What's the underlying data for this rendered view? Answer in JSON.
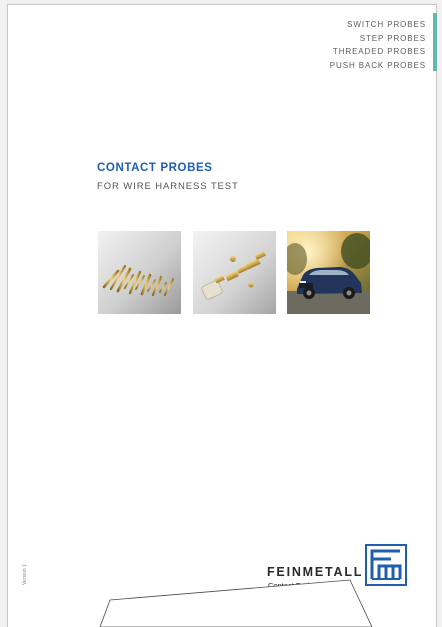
{
  "side_nav": {
    "items": [
      {
        "label": "SWITCH PROBES"
      },
      {
        "label": "STEP PROBES"
      },
      {
        "label": "THREADED PROBES"
      },
      {
        "label": "PUSH BACK PROBES"
      }
    ]
  },
  "cover": {
    "title": "CONTACT PROBES",
    "subtitle": "FOR WIRE HARNESS TEST"
  },
  "photos": [
    {
      "icon": "contact-probes-photo"
    },
    {
      "icon": "probe-components-photo"
    },
    {
      "icon": "car-photo"
    }
  ],
  "version_label": "Version 1",
  "logo": {
    "wordmark": "FEINMETALL",
    "tagline": "Contact Technologies",
    "color": "#1f5fae"
  },
  "colors": {
    "accent": "#60b8b2",
    "title": "#1f5fae",
    "text": "#555555"
  }
}
